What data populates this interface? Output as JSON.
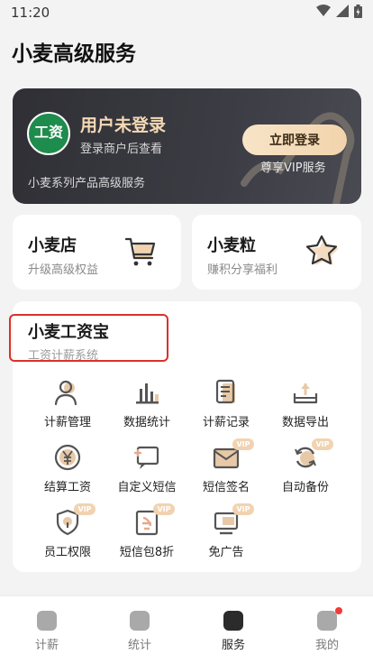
{
  "status": {
    "time": "11:20"
  },
  "page": {
    "title": "小麦高级服务"
  },
  "vip_card": {
    "logo_text": "工资",
    "user_title": "用户未登录",
    "user_sub": "登录商户后查看",
    "series_text": "小麦系列产品高级服务",
    "login_button": "立即登录",
    "vip_text": "尊享VIP服务"
  },
  "shortcuts": [
    {
      "title": "小麦店",
      "subtitle": "升级高级权益"
    },
    {
      "title": "小麦粒",
      "subtitle": "赚积分享福利"
    }
  ],
  "section": {
    "title": "小麦工资宝",
    "subtitle": "工资计薪系统",
    "items": [
      {
        "label": "计薪管理",
        "icon": "user-icon"
      },
      {
        "label": "数据统计",
        "icon": "bar-chart-icon"
      },
      {
        "label": "计薪记录",
        "icon": "document-icon"
      },
      {
        "label": "数据导出",
        "icon": "upload-icon"
      },
      {
        "label": "结算工资",
        "icon": "yen-icon"
      },
      {
        "label": "自定义短信",
        "icon": "message-add-icon"
      },
      {
        "label": "短信签名",
        "icon": "mail-icon",
        "vip": "VIP"
      },
      {
        "label": "自动备份",
        "icon": "cloud-sync-icon",
        "vip": "VIP"
      },
      {
        "label": "员工权限",
        "icon": "shield-icon",
        "vip": "VIP"
      },
      {
        "label": "短信包8折",
        "icon": "discount-icon",
        "vip": "VIP"
      },
      {
        "label": "免广告",
        "icon": "monitor-icon",
        "vip": "VIP"
      }
    ]
  },
  "tabs": [
    {
      "label": "计薪",
      "icon": "salary-icon"
    },
    {
      "label": "统计",
      "icon": "stats-icon"
    },
    {
      "label": "服务",
      "icon": "diamond-icon",
      "active": true
    },
    {
      "label": "我的",
      "icon": "profile-icon"
    }
  ],
  "colors": {
    "accent": "#2f2f35",
    "gold": "#f4d9b4",
    "highlight": "#d8322a",
    "icon_primary": "#5a5a5a",
    "icon_secondary": "#d8b899"
  }
}
